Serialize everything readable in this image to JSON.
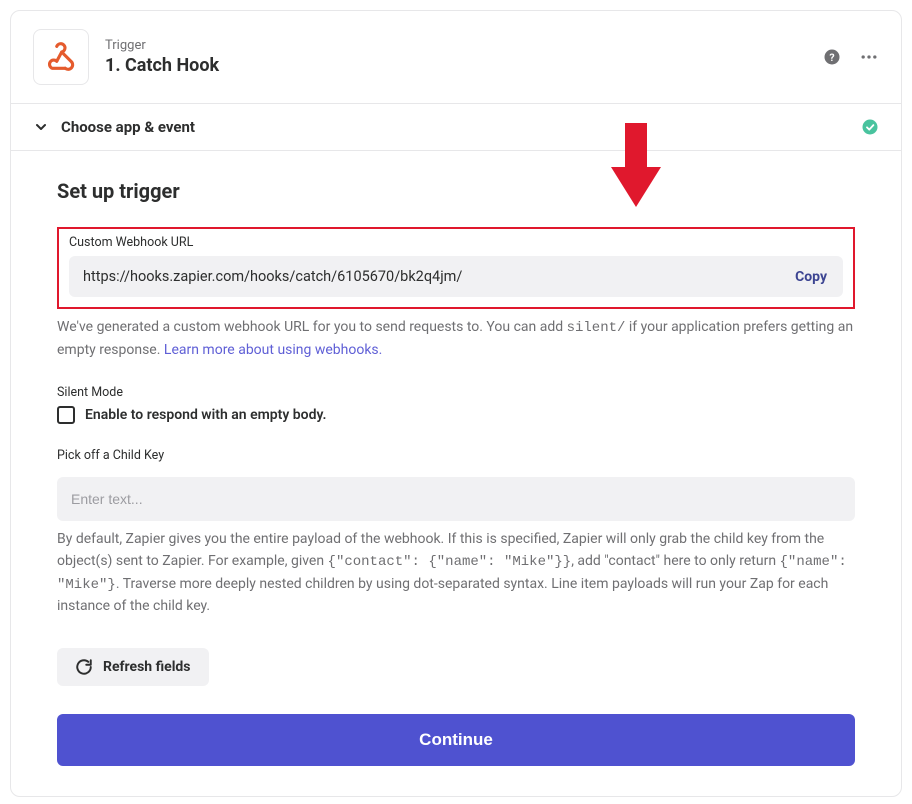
{
  "header": {
    "eyebrow": "Trigger",
    "title": "1. Catch Hook"
  },
  "section_row": {
    "label": "Choose app & event"
  },
  "setup": {
    "heading": "Set up trigger",
    "webhook": {
      "label": "Custom Webhook URL",
      "url": "https://hooks.zapier.com/hooks/catch/6105670/bk2q4jm/",
      "copy_label": "Copy",
      "help_prefix": "We've generated a custom webhook URL for you to send requests to. You can add ",
      "help_code": "silent/",
      "help_suffix": " if your application prefers getting an empty response. ",
      "learn_more": "Learn more about using webhooks."
    },
    "silent": {
      "label": "Silent Mode",
      "checkbox_label": "Enable to respond with an empty body."
    },
    "childkey": {
      "label": "Pick off a Child Key",
      "placeholder": "Enter text...",
      "help_a": "By default, Zapier gives you the entire payload of the webhook. If this is specified, Zapier will only grab the child key from the object(s) sent to Zapier. For example, given ",
      "help_code1": "{\"contact\": {\"name\": \"Mike\"}}",
      "help_b": ", add \"contact\" here to only return ",
      "help_code2": "{\"name\": \"Mike\"}",
      "help_c": ". Traverse more deeply nested children by using dot-separated syntax. Line item payloads will run your Zap for each instance of the child key."
    },
    "refresh_label": "Refresh fields",
    "continue_label": "Continue"
  }
}
